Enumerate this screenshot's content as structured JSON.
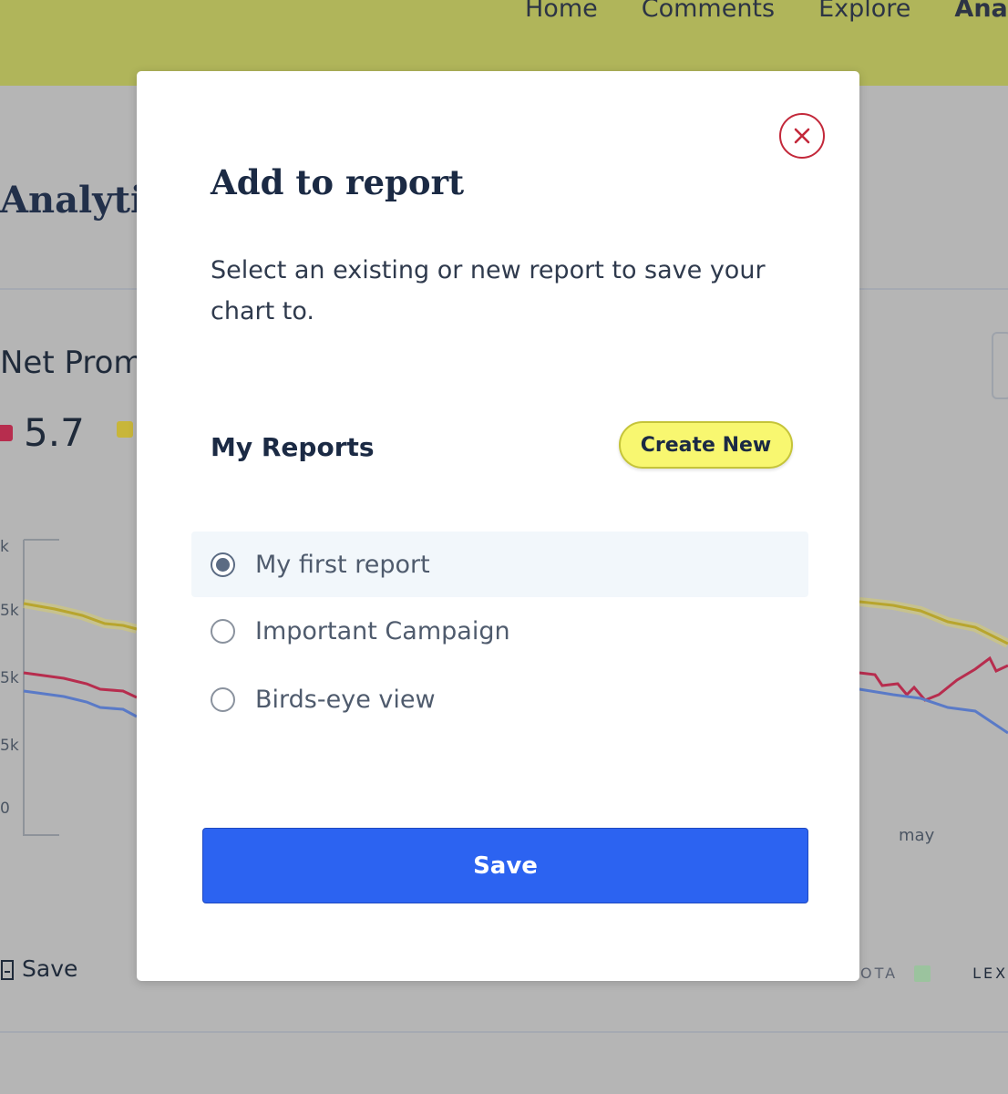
{
  "nav": {
    "items": [
      "Home",
      "Comments",
      "Explore",
      "Analy"
    ],
    "active_index": 3
  },
  "background": {
    "page_title": "Analytic",
    "chart_title": "Net Prom",
    "stat_value": "5.7",
    "y_ticks": [
      "k",
      "5k",
      "5k",
      "5k",
      "0"
    ],
    "x_label": "may",
    "save_label": "Save",
    "legend_right": [
      "OTA",
      "LEX"
    ],
    "colors": {
      "series_red": "#b72d4e",
      "series_yellow": "#c8b63a",
      "series_blue": "#5a7ac7"
    }
  },
  "modal": {
    "title": "Add to report",
    "description": "Select an existing or new report to save your chart to.",
    "section_title": "My Reports",
    "create_new_label": "Create New",
    "reports": [
      {
        "label": "My first report",
        "selected": true
      },
      {
        "label": "Important Campaign",
        "selected": false
      },
      {
        "label": "Birds-eye view",
        "selected": false
      }
    ],
    "save_label": "Save",
    "colors": {
      "primary": "#2c63f1",
      "accent_yellow": "#f8f770",
      "close_red": "#c3283a"
    }
  }
}
